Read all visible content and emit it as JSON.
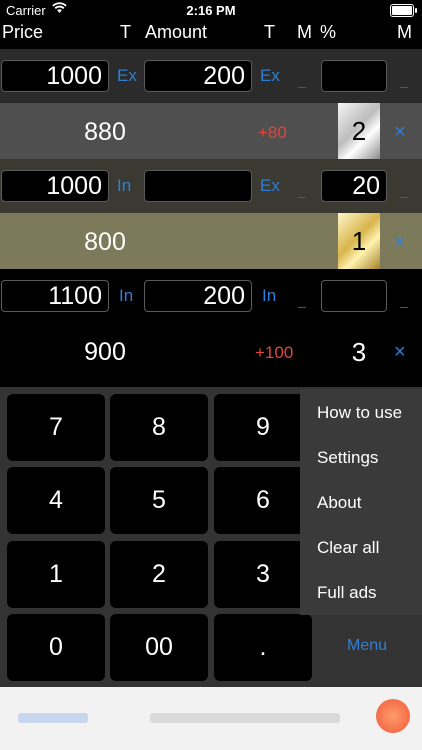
{
  "status": {
    "carrier": "Carrier",
    "time": "2:16 PM"
  },
  "header": {
    "price": "Price",
    "t1": "T",
    "amount": "Amount",
    "t2": "T",
    "m1": "M",
    "percent": "%",
    "m2": "M"
  },
  "rows": [
    {
      "price": "1000",
      "price_type": "Ex",
      "amount": "200",
      "amount_type": "Ex",
      "percent": "",
      "result": "880",
      "diff": "+80",
      "rank": "2",
      "close": "×"
    },
    {
      "price": "1000",
      "price_type": "In",
      "amount": "",
      "amount_type": "Ex",
      "percent": "20",
      "result": "800",
      "diff": "",
      "rank": "1",
      "close": "×"
    },
    {
      "price": "1100",
      "price_type": "In",
      "amount": "200",
      "amount_type": "In",
      "percent": "",
      "result": "900",
      "diff": "+100",
      "rank": "3",
      "close": "×"
    }
  ],
  "keypad": [
    "7",
    "8",
    "9",
    "4",
    "5",
    "6",
    "1",
    "2",
    "3",
    "0",
    "00",
    "."
  ],
  "menu": {
    "items": [
      "How to use",
      "Settings",
      "About",
      "Clear all",
      "Full ads"
    ],
    "button": "Menu"
  },
  "colors": {
    "accent": "#2f7fd6",
    "diff": "#e2463a",
    "row1_input": "#2b2b2b",
    "row1_result": "#4f4f4f",
    "row2_input": "#3a3a33",
    "row2_result": "#7c7a5a"
  }
}
